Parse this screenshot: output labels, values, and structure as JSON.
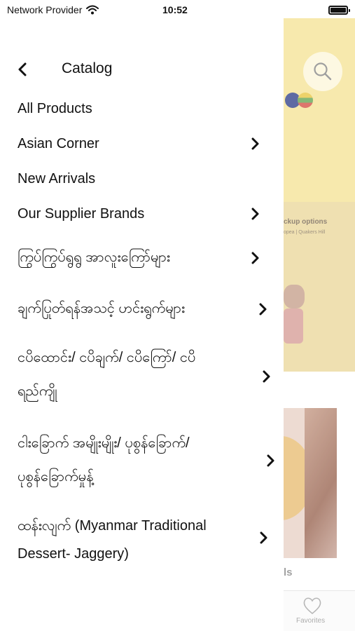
{
  "status_bar": {
    "carrier": "Network Provider",
    "time": "10:52"
  },
  "menu": {
    "title": "Catalog",
    "items": [
      {
        "label": "All Products",
        "has_submenu": false
      },
      {
        "label": "Asian Corner",
        "has_submenu": true
      },
      {
        "label": "New Arrivals",
        "has_submenu": false
      },
      {
        "label": "Our Supplier Brands",
        "has_submenu": true
      },
      {
        "label": "ကြွပ်ကြွပ်ရွရွ အာလူးကြော်များ",
        "has_submenu": true
      },
      {
        "label": "ချက်ပြုတ်ရန်အသင့် ဟင်းရွက်များ",
        "has_submenu": true
      },
      {
        "label_line1": "ငပိထောင်း/ ငပိချက်/ ငပိကြော်/ ငပိ",
        "label_line2": "ရည်ကျို",
        "has_submenu": true
      },
      {
        "label_line1": "ငါးခြောက် အမျိုးမျိုး/ ပုစွန်ခြောက်/",
        "label_line2": "ပုစွန်ခြောက်မှုန့်",
        "has_submenu": true
      },
      {
        "label_line1": "ထန်းလျက် (Myanmar Traditional",
        "label_line2": "Dessert- Jaggery)",
        "has_submenu": true
      }
    ]
  },
  "background": {
    "banner_text": "ckup options",
    "banner_subtext": "opea | Quakers Hill",
    "section_fragment": "ls",
    "tab_favorites": "Favorites"
  }
}
